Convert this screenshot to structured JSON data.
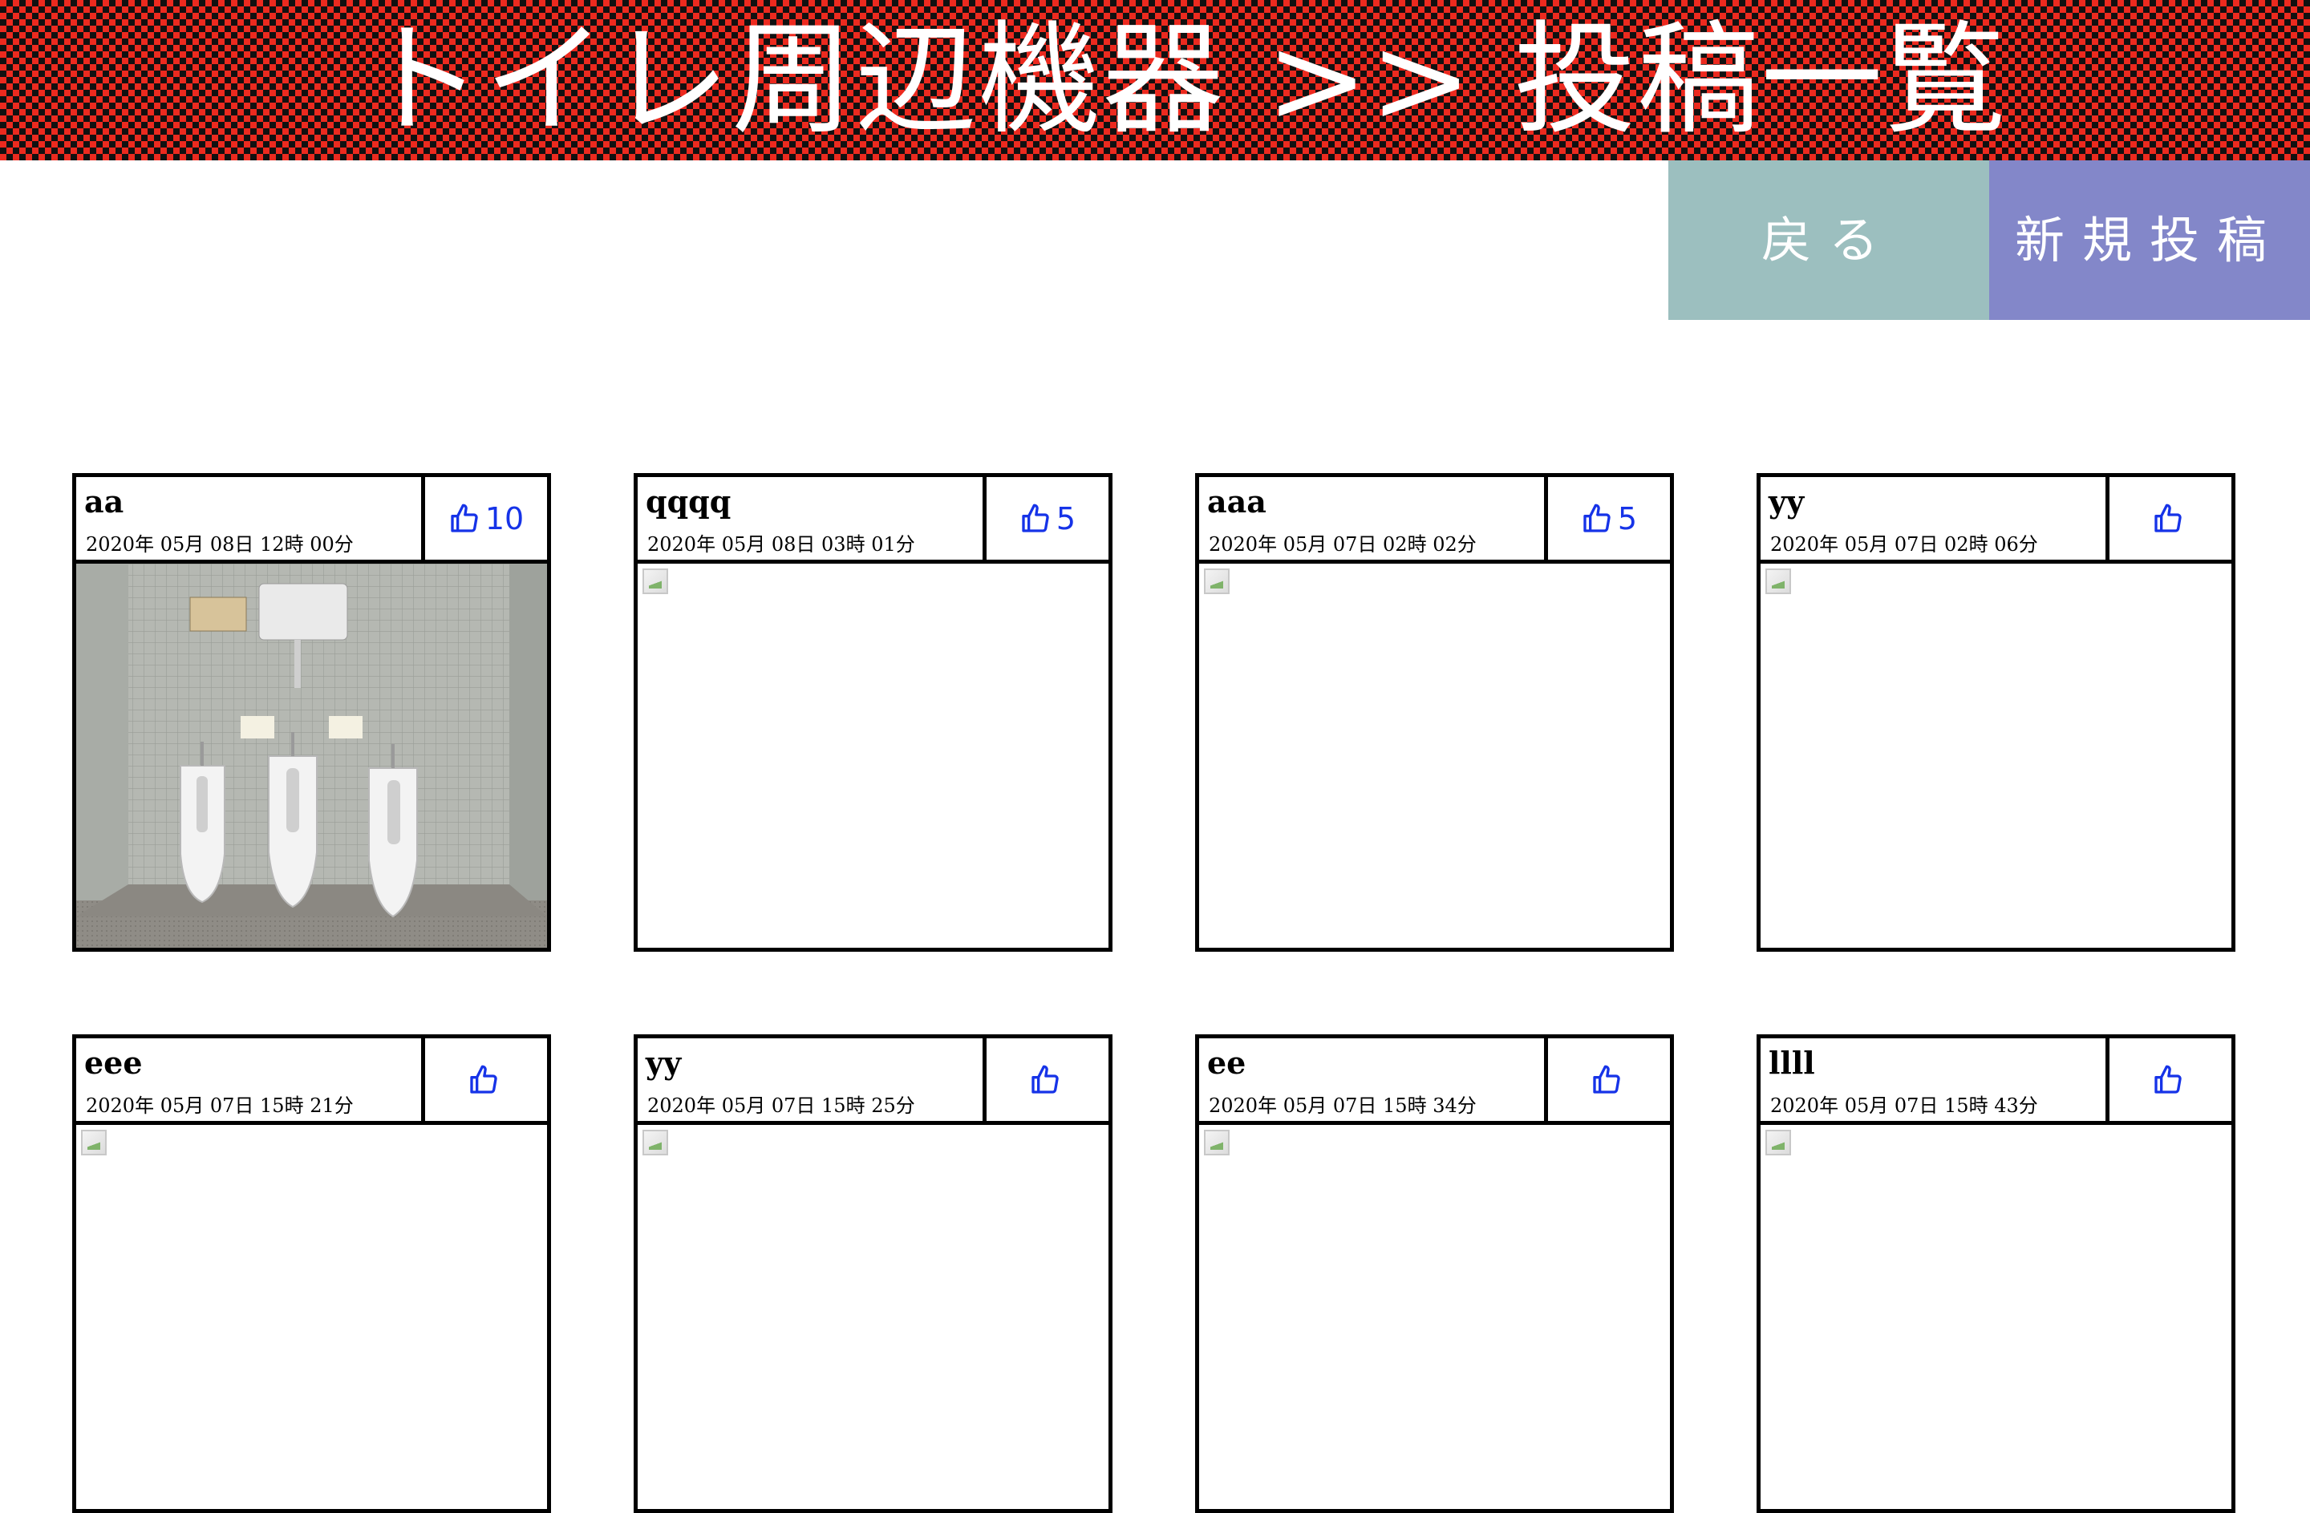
{
  "header": {
    "title": "トイレ周辺機器 >> 投稿一覧"
  },
  "nav": {
    "back_label": "戻る",
    "new_post_label": "新規投稿"
  },
  "colors": {
    "header_red": "#ec2a1f",
    "header_dark": "#111111",
    "back_button": "#9cbfbf",
    "new_post_button": "#8387c9",
    "like_blue": "#1633e8"
  },
  "icons": {
    "like": "thumbs-up-icon",
    "broken_image": "broken-image-icon"
  },
  "posts": [
    {
      "title": "aa",
      "date": "2020年 05月 08日 12時 00分",
      "likes": "10",
      "image": "urinals-photo"
    },
    {
      "title": "qqqq",
      "date": "2020年 05月 08日 03時 01分",
      "likes": "5",
      "image": "broken"
    },
    {
      "title": "aaa",
      "date": "2020年 05月 07日 02時 02分",
      "likes": "5",
      "image": "broken"
    },
    {
      "title": "yy",
      "date": "2020年 05月 07日 02時 06分",
      "likes": "",
      "image": "broken"
    },
    {
      "title": "eee",
      "date": "2020年 05月 07日 15時 21分",
      "likes": "",
      "image": "broken"
    },
    {
      "title": "yy",
      "date": "2020年 05月 07日 15時 25分",
      "likes": "",
      "image": "broken"
    },
    {
      "title": "ee",
      "date": "2020年 05月 07日 15時 34分",
      "likes": "",
      "image": "broken"
    },
    {
      "title": "llll",
      "date": "2020年 05月 07日 15時 43分",
      "likes": "",
      "image": "broken"
    }
  ]
}
